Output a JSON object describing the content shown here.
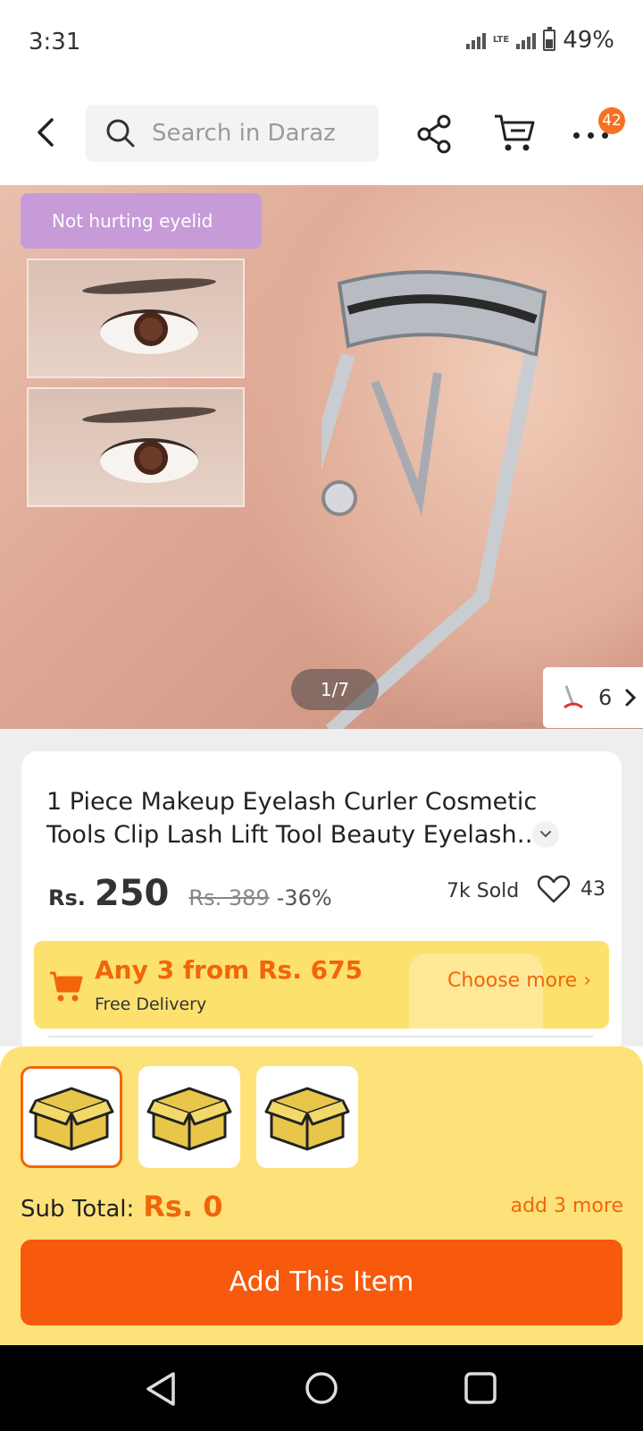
{
  "status_bar": {
    "time": "3:31",
    "network": "LTE",
    "battery": "49%"
  },
  "header": {
    "search_placeholder": "Search in Daraz",
    "cart_badge": "42",
    "icons": [
      "back-arrow-icon",
      "search-icon",
      "share-icon",
      "cart-icon",
      "more-icon"
    ]
  },
  "gallery": {
    "overlay_tag": "Not hurting eyelid",
    "pager": "1/7",
    "variants_count": "6"
  },
  "product": {
    "title": "1 Piece Makeup Eyelash Curler Cosmetic Tools Clip Lash Lift Tool Beauty Eyelash…",
    "currency": "Rs.",
    "price": "250",
    "original_price": "Rs. 389",
    "discount": "-36%",
    "sold": "7k Sold",
    "wishlist_count": "43"
  },
  "promo": {
    "title": "Any 3 from Rs. 675",
    "subtitle": "Free Delivery",
    "action": "Choose more"
  },
  "bundle": {
    "slots": [
      {
        "icon": "box-icon",
        "selected": true
      },
      {
        "icon": "box-icon",
        "selected": false
      },
      {
        "icon": "box-icon",
        "selected": false
      }
    ],
    "subtotal_label": "Sub Total:",
    "subtotal_value": "Rs. 0",
    "add_more": "add 3 more",
    "button_label": "Add This Item"
  },
  "colors": {
    "accent": "#f2650b",
    "button": "#f75a0c",
    "promo_bg": "#fde16f",
    "sheet_bg": "#fde27a"
  }
}
